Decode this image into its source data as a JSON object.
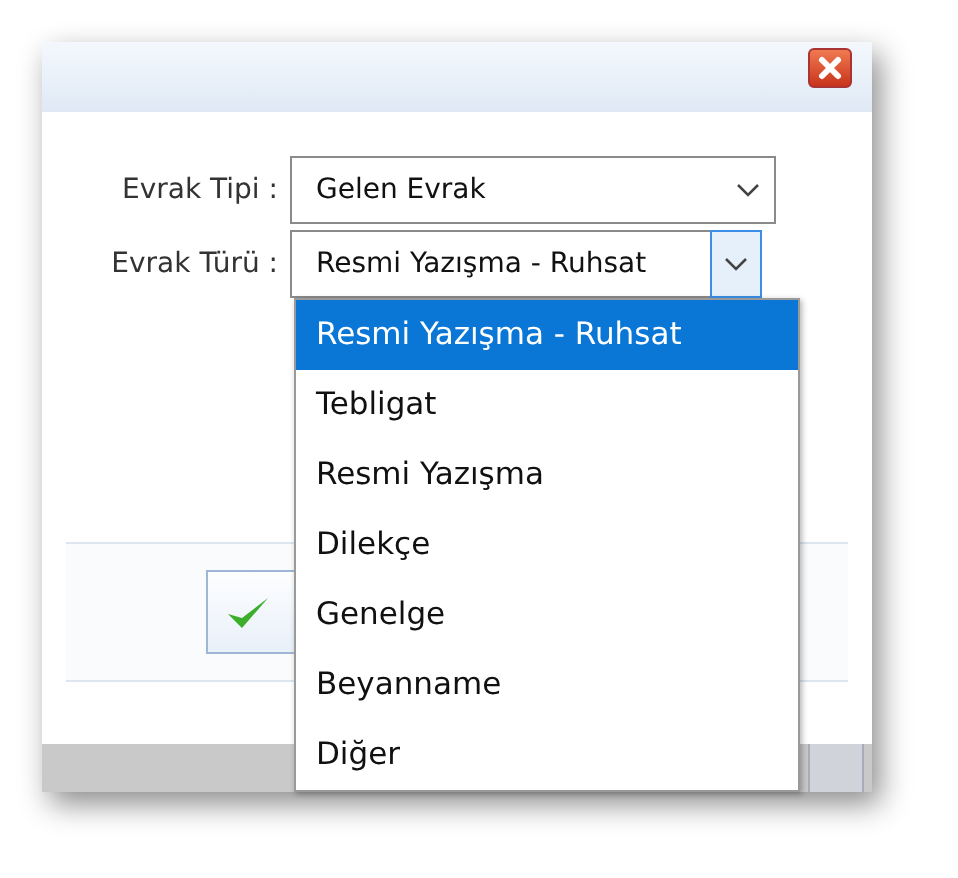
{
  "fields": [
    {
      "label": "Evrak Tipi :",
      "value": "Gelen Evrak",
      "open": false
    },
    {
      "label": "Evrak Türü :",
      "value": "Resmi Yazışma - Ruhsat",
      "open": true
    }
  ],
  "dropdown": {
    "items": [
      {
        "label": "Resmi Yazışma - Ruhsat",
        "selected": true
      },
      {
        "label": "Tebligat",
        "selected": false
      },
      {
        "label": "Resmi Yazışma",
        "selected": false
      },
      {
        "label": "Dilekçe",
        "selected": false
      },
      {
        "label": "Genelge",
        "selected": false
      },
      {
        "label": "Beyanname",
        "selected": false
      },
      {
        "label": "Diğer",
        "selected": false
      }
    ]
  }
}
